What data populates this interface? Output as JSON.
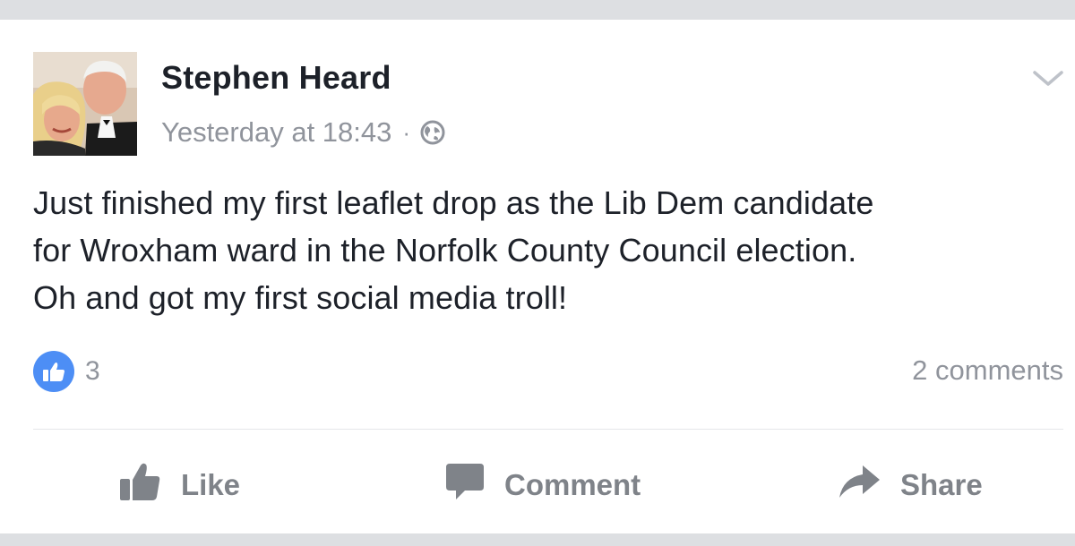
{
  "post": {
    "author": "Stephen Heard",
    "timestamp": "Yesterday at 18:43",
    "separator": "·",
    "privacy_icon": "globe-icon",
    "menu_icon": "chevron-down-icon",
    "text_lines": [
      "Just finished my first leaflet drop as the Lib Dem candidate",
      "for Wroxham ward in the Norfolk County Council election.",
      "Oh and got my first social media troll!"
    ]
  },
  "reactions": {
    "icon": "thumbs-up-icon",
    "like_count": "3",
    "comments": "2 comments"
  },
  "actions": {
    "like_label": "Like",
    "comment_label": "Comment",
    "share_label": "Share"
  },
  "colors": {
    "background": "#dddfe2",
    "card": "#ffffff",
    "text": "#1d2129",
    "muted": "#90949c",
    "action": "#7f8389",
    "like_blue": "#4d8ef5"
  }
}
